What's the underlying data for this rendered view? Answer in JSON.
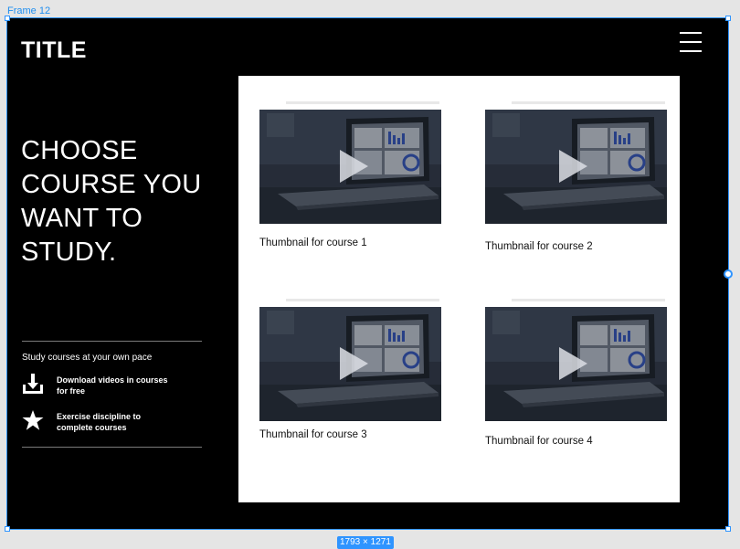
{
  "editor": {
    "frame_label": "Frame 12",
    "size_label": "1793 × 1271"
  },
  "page": {
    "title": "TITLE",
    "headline_lines": [
      "CHOOSE",
      "COURSE YOU",
      "WANT TO",
      "STUDY."
    ],
    "features_heading": "Study courses at your own pace",
    "features": [
      {
        "icon": "download-icon",
        "text": "Download videos in courses for free"
      },
      {
        "icon": "star-icon",
        "text": "Exercise discipline to complete courses"
      }
    ]
  },
  "courses": [
    {
      "caption": "Thumbnail for course 1",
      "icon": "play-icon"
    },
    {
      "caption": "Thumbnail for course 2",
      "icon": "play-icon"
    },
    {
      "caption": "Thumbnail for course 3",
      "icon": "play-icon"
    },
    {
      "caption": "Thumbnail for course 4",
      "icon": "play-icon"
    }
  ],
  "colors": {
    "background": "#000000",
    "selection": "#2f94ff",
    "panel": "#ffffff",
    "text_light": "#ffffff",
    "text_dark": "#111111"
  }
}
